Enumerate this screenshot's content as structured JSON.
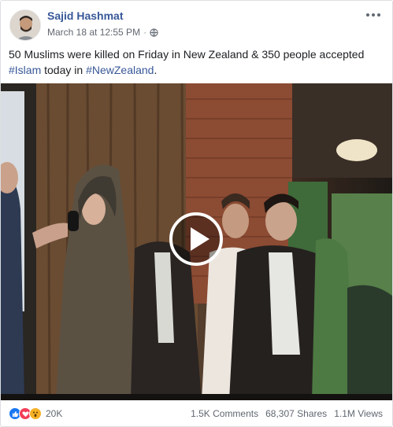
{
  "post": {
    "author": "Sajid Hashmat",
    "timestamp": "March 18 at 12:55 PM",
    "separator": "·",
    "privacy_icon": "globe-icon",
    "more_icon": "more-options-icon",
    "text_prefix": "50 Muslims were killed on Friday in New Zealand & 350 people accepted",
    "hashtag_1": "#Islam",
    "text_middle": " today in ",
    "hashtag_2": "#NewZealand",
    "text_suffix": "."
  },
  "video": {
    "play_icon": "play-icon"
  },
  "footer": {
    "reaction_icons": [
      "like-icon",
      "love-icon",
      "wow-icon"
    ],
    "reaction_count": "20K",
    "comments": "1.5K Comments",
    "shares": "68,307 Shares",
    "views": "1.1M Views"
  },
  "colors": {
    "link": "#385898",
    "like": "#1877f2",
    "love": "#f33e58",
    "wow": "#f7b125"
  }
}
